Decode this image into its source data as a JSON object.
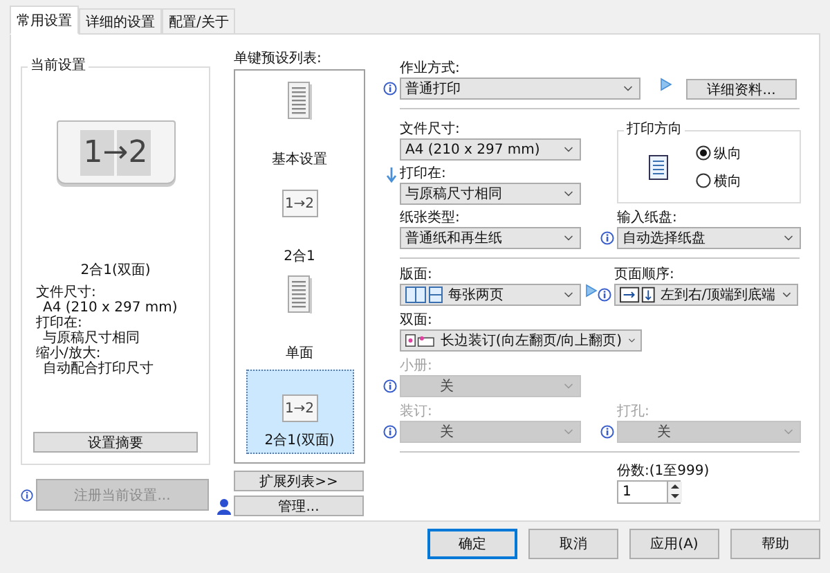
{
  "tabs": [
    {
      "label": "常用设置",
      "selected": true
    },
    {
      "label": "详细的设置",
      "selected": false
    },
    {
      "label": "配置/关于",
      "selected": false
    }
  ],
  "current_settings": {
    "title": "当前设置",
    "preview_text": "1→2",
    "preview_label": "2合1(双面)",
    "details": [
      {
        "label": "文件尺寸:",
        "value": "A4 (210 x 297 mm)"
      },
      {
        "label": "打印在:",
        "value": "与原稿尺寸相同"
      },
      {
        "label": "缩小/放大:",
        "value": "自动配合打印尺寸"
      }
    ],
    "summary_button": "设置摘要"
  },
  "register_button": {
    "label": "注册当前设置...",
    "disabled": true,
    "info": true
  },
  "presets": {
    "title": "单键预设列表:",
    "items": [
      {
        "label": "基本设置",
        "kind": "document",
        "selected": false
      },
      {
        "label": "2合1",
        "kind": "two_in_one",
        "icon_text": "1→2",
        "selected": false
      },
      {
        "label": "单面",
        "kind": "document",
        "selected": false
      },
      {
        "label": "2合1(双面)",
        "kind": "two_in_one_duplex",
        "icon_text": "1→2",
        "selected": true
      }
    ],
    "expand_button": "扩展列表>>",
    "manage_button": "管理..."
  },
  "job": {
    "label": "作业方式:",
    "value": "普通打印",
    "info": true,
    "disabled": false,
    "details_button": "详细资料..."
  },
  "paper_size": {
    "label": "文件尺寸:",
    "value": "A4 (210 x 297 mm)",
    "disabled": false
  },
  "print_on": {
    "label": "打印在:",
    "value": "与原稿尺寸相同",
    "disabled": false
  },
  "orientation": {
    "title": "打印方向",
    "options": [
      {
        "label": "纵向",
        "selected": true
      },
      {
        "label": "横向",
        "selected": false
      }
    ]
  },
  "paper_type": {
    "label": "纸张类型:",
    "value": "普通纸和再生纸",
    "disabled": false
  },
  "input_tray": {
    "label": "输入纸盘:",
    "value": "自动选择纸盘",
    "info": true,
    "disabled": false
  },
  "layout": {
    "label": "版面:",
    "value": "每张两页",
    "disabled": false
  },
  "page_order": {
    "label": "页面顺序:",
    "value": "左到右/顶端到底端",
    "info": true,
    "disabled": false
  },
  "duplex": {
    "label": "双面:",
    "value": "长边装订(向左翻页/向上翻页)",
    "disabled": false
  },
  "booklet": {
    "label": "小册:",
    "value": "关",
    "info": true,
    "disabled": true
  },
  "binding": {
    "label": "装订:",
    "value": "关",
    "info": true,
    "disabled": true
  },
  "punch": {
    "label": "打孔:",
    "value": "关",
    "info": true,
    "disabled": true
  },
  "copies": {
    "label": "份数:(1至999)",
    "value": "1"
  },
  "buttons": [
    {
      "label": "确定",
      "default": true
    },
    {
      "label": "取消",
      "default": false
    },
    {
      "label": "应用(A)",
      "default": false
    },
    {
      "label": "帮助",
      "default": false
    }
  ]
}
